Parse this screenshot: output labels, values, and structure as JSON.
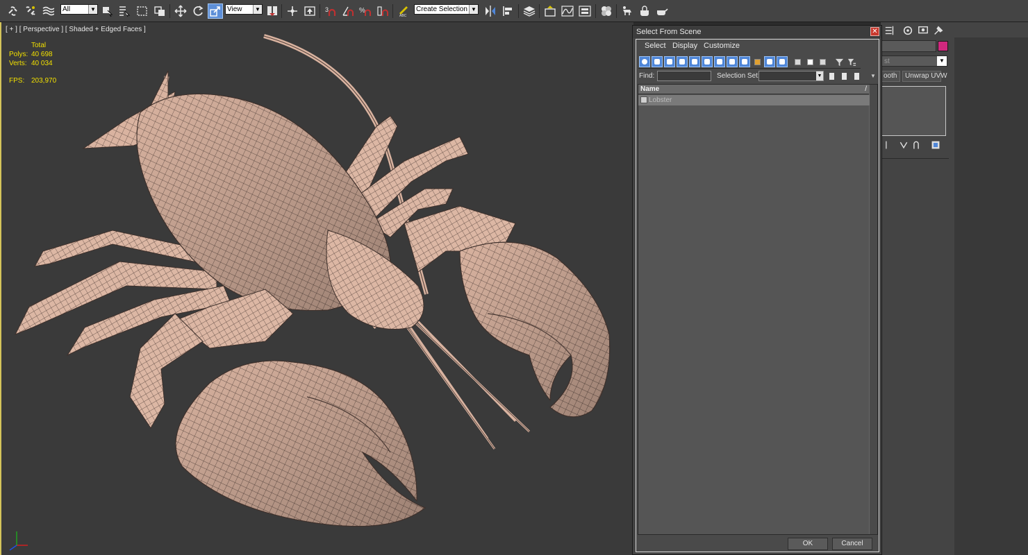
{
  "toolbar": {
    "selection_filter": "All",
    "reference_coord": "View",
    "named_selection_placeholder": "Create Selection Se",
    "icons": [
      "link-icon",
      "unlink-icon",
      "bind-space-warp-icon",
      "select-object-icon",
      "select-by-name-icon",
      "rectangular-selection-icon",
      "window-crossing-icon",
      "move-icon",
      "rotate-icon",
      "scale-icon",
      "select-manipulate-icon",
      "pivot-icon",
      "keyboard-shortcut-icon",
      "snap-3d-icon",
      "angle-snap-icon",
      "percent-snap-icon",
      "spinner-snap-icon",
      "edit-named-selection-icon",
      "mirror-icon",
      "align-icon",
      "layer-manager-icon",
      "toggle-ribbon-icon",
      "curve-editor-icon",
      "schematic-view-icon",
      "material-editor-icon",
      "render-setup-icon",
      "rendered-frame-icon",
      "render-icon"
    ]
  },
  "viewport": {
    "label": "[ + ] [ Perspective ] [ Shaded + Edged Faces ]",
    "stats": {
      "total_label": "Total",
      "polys_label": "Polys:",
      "polys_value": "40 698",
      "verts_label": "Verts:",
      "verts_value": "40 034",
      "fps_label": "FPS:",
      "fps_value": "203,970"
    },
    "accent_color": "#f2e000"
  },
  "dialog": {
    "title": "Select From Scene",
    "close_glyph": "✕",
    "menu": [
      "Select",
      "Display",
      "Customize"
    ],
    "find_label": "Find:",
    "find_value": "",
    "selection_set_label": "Selection Set:",
    "list_header": "Name",
    "sort_indicator": "/",
    "rows": [
      "Lobster"
    ],
    "ok_label": "OK",
    "cancel_label": "Cancel"
  },
  "command_panel": {
    "modifier_list": "st",
    "tab_smooth": "ooth",
    "tab_unwrap": "Unwrap UVW",
    "object_color": "#d0287e"
  }
}
